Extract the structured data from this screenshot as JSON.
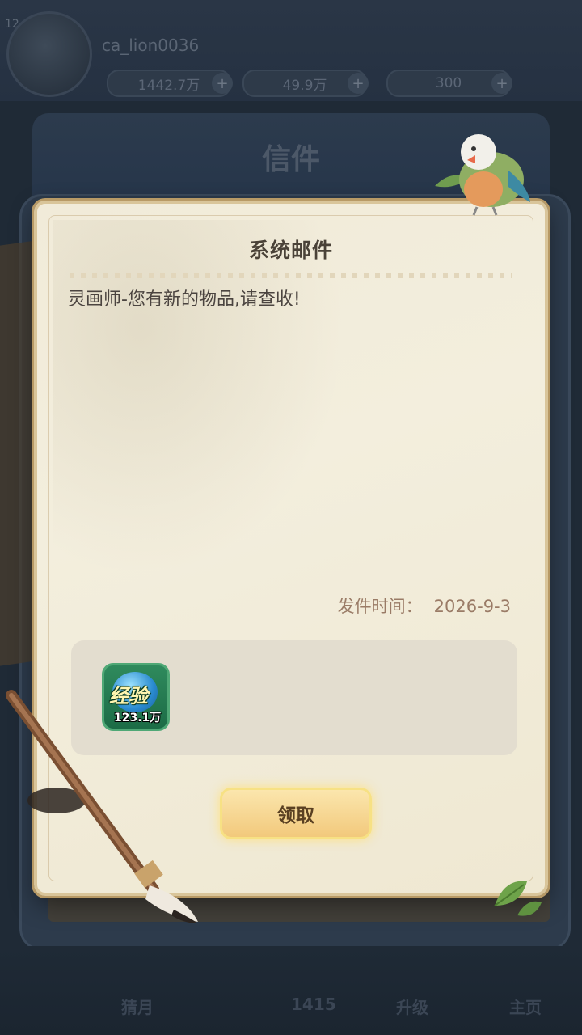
{
  "background": {
    "level": "12",
    "player_name": "ca_lion0036",
    "currency_1": "1442.7万",
    "currency_2": "49.9万",
    "currency_3": "300",
    "screen_title": "信件",
    "nav_labels": [
      "猜月",
      "1415",
      "升级",
      "主页"
    ]
  },
  "mail": {
    "title": "系统邮件",
    "message": "灵画师-您有新的物品,请查收!",
    "send_time_label": "发件时间：",
    "send_time_value": "2026-9-3",
    "reward": {
      "name": "经验",
      "quantity": "123.1万",
      "icon": "experience-orb-icon"
    },
    "claim_label": "领取"
  },
  "colors": {
    "paper": "#f1ebd9",
    "title_text": "#4a4238",
    "time_text": "#9a7b66",
    "button": "#f2c97c"
  }
}
